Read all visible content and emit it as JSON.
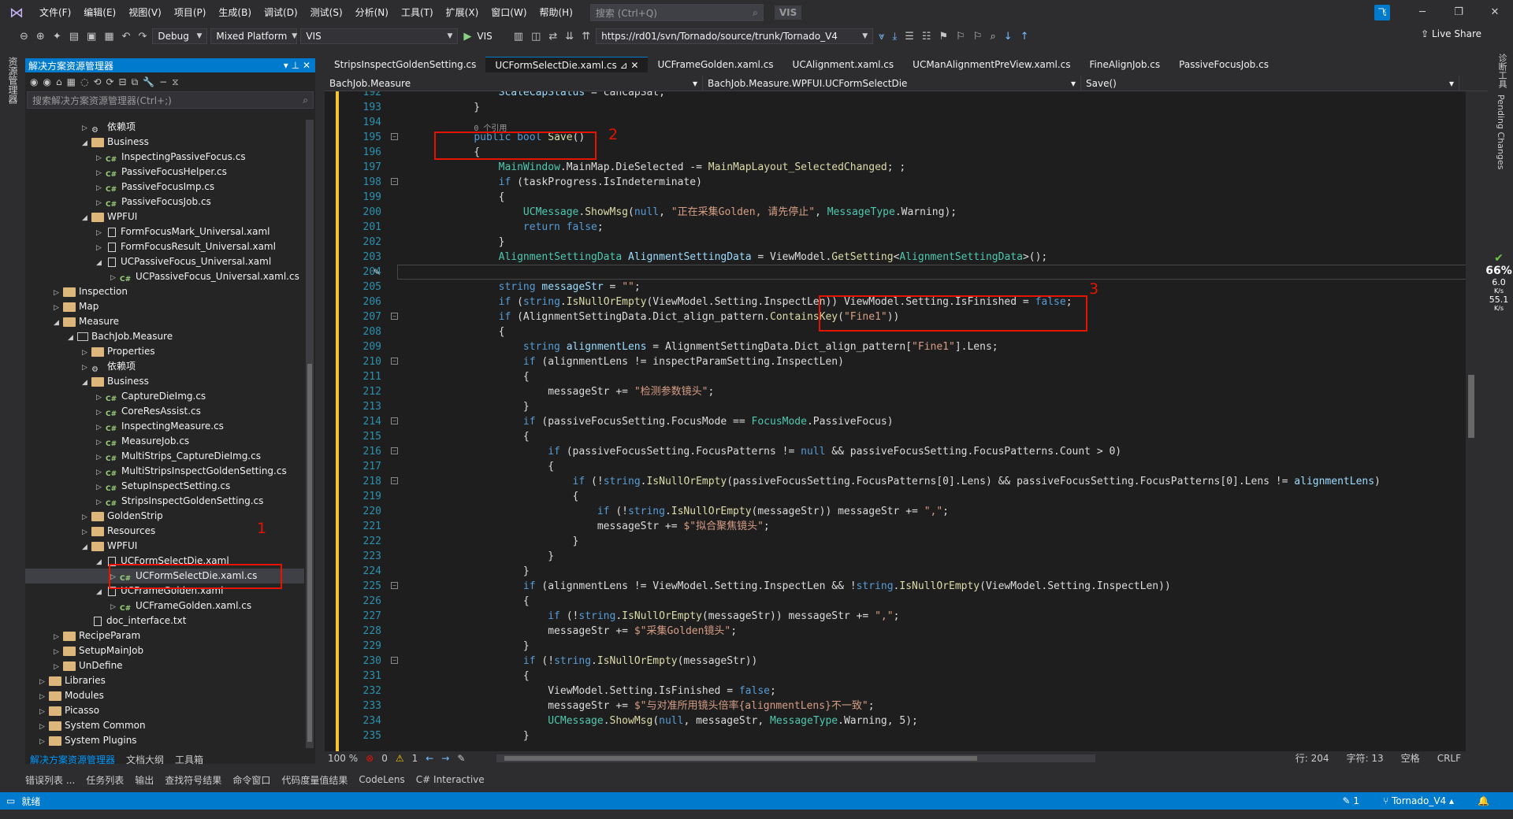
{
  "titlebar": {
    "logo": "VS",
    "menu": [
      "文件(F)",
      "编辑(E)",
      "视图(V)",
      "项目(P)",
      "生成(B)",
      "调试(D)",
      "测试(S)",
      "分析(N)",
      "工具(T)",
      "扩展(X)",
      "窗口(W)",
      "帮助(H)"
    ],
    "search_placeholder": "搜索 (Ctrl+Q)",
    "tag": "VIS",
    "avatar": "飞",
    "minimize": "─",
    "restore": "❐",
    "close": "✕"
  },
  "toolbar": {
    "config": "Debug",
    "platform": "Mixed Platform",
    "startup": "VIS",
    "run_label": "VIS",
    "url": "https://rd01/svn/Tornado/source/trunk/Tornado_V4",
    "live_share": "Live Share"
  },
  "left_strip": {
    "label": "资源管理器"
  },
  "right_strip": {
    "labels": [
      "诊断工具",
      "Pending Changes"
    ]
  },
  "solution": {
    "title": "解决方案资源管理器",
    "search_placeholder": "搜索解决方案资源管理器(Ctrl+;)",
    "tabs": [
      "解决方案资源管理器",
      "文档大纲",
      "工具箱"
    ],
    "tree": [
      {
        "label": "依赖项",
        "indent": 4,
        "icon": "ref",
        "arrow": "▷"
      },
      {
        "label": "Business",
        "indent": 4,
        "icon": "folder",
        "arrow": "◢"
      },
      {
        "label": "InspectingPassiveFocus.cs",
        "indent": 5,
        "icon": "cs",
        "arrow": "▷"
      },
      {
        "label": "PassiveFocusHelper.cs",
        "indent": 5,
        "icon": "cs",
        "arrow": "▷"
      },
      {
        "label": "PassiveFocusImp.cs",
        "indent": 5,
        "icon": "cs",
        "arrow": "▷"
      },
      {
        "label": "PassiveFocusJob.cs",
        "indent": 5,
        "icon": "cs",
        "arrow": "▷"
      },
      {
        "label": "WPFUI",
        "indent": 4,
        "icon": "folder",
        "arrow": "◢"
      },
      {
        "label": "FormFocusMark_Universal.xaml",
        "indent": 5,
        "icon": "xaml",
        "arrow": "▷"
      },
      {
        "label": "FormFocusResult_Universal.xaml",
        "indent": 5,
        "icon": "xaml",
        "arrow": "▷"
      },
      {
        "label": "UCPassiveFocus_Universal.xaml",
        "indent": 5,
        "icon": "xaml",
        "arrow": "◢"
      },
      {
        "label": "UCPassiveFocus_Universal.xaml.cs",
        "indent": 6,
        "icon": "cs",
        "arrow": "▷"
      },
      {
        "label": "Inspection",
        "indent": 2,
        "icon": "folder",
        "arrow": "▷"
      },
      {
        "label": "Map",
        "indent": 2,
        "icon": "folder",
        "arrow": "▷"
      },
      {
        "label": "Measure",
        "indent": 2,
        "icon": "folder",
        "arrow": "◢"
      },
      {
        "label": "BachJob.Measure",
        "indent": 3,
        "icon": "proj",
        "arrow": "◢"
      },
      {
        "label": "Properties",
        "indent": 4,
        "icon": "folder",
        "arrow": "▷"
      },
      {
        "label": "依赖项",
        "indent": 4,
        "icon": "ref",
        "arrow": "▷"
      },
      {
        "label": "Business",
        "indent": 4,
        "icon": "folder",
        "arrow": "◢"
      },
      {
        "label": "CaptureDieImg.cs",
        "indent": 5,
        "icon": "cs",
        "arrow": "▷"
      },
      {
        "label": "CoreResAssist.cs",
        "indent": 5,
        "icon": "cs",
        "arrow": "▷"
      },
      {
        "label": "InspectingMeasure.cs",
        "indent": 5,
        "icon": "cs",
        "arrow": "▷"
      },
      {
        "label": "MeasureJob.cs",
        "indent": 5,
        "icon": "cs",
        "arrow": "▷"
      },
      {
        "label": "MultiStrips_CaptureDieImg.cs",
        "indent": 5,
        "icon": "cs",
        "arrow": "▷"
      },
      {
        "label": "MultiStripsInspectGoldenSetting.cs",
        "indent": 5,
        "icon": "cs",
        "arrow": "▷"
      },
      {
        "label": "SetupInspectSetting.cs",
        "indent": 5,
        "icon": "cs",
        "arrow": "▷"
      },
      {
        "label": "StripsInspectGoldenSetting.cs",
        "indent": 5,
        "icon": "cs",
        "arrow": "▷"
      },
      {
        "label": "GoldenStrip",
        "indent": 4,
        "icon": "folder",
        "arrow": "▷"
      },
      {
        "label": "Resources",
        "indent": 4,
        "icon": "folder",
        "arrow": "▷"
      },
      {
        "label": "WPFUI",
        "indent": 4,
        "icon": "folder",
        "arrow": "◢"
      },
      {
        "label": "UCFormSelectDie.xaml",
        "indent": 5,
        "icon": "xaml",
        "arrow": "◢"
      },
      {
        "label": "UCFormSelectDie.xaml.cs",
        "indent": 6,
        "icon": "cs",
        "arrow": "▷",
        "selected": true
      },
      {
        "label": "UCFrameGolden.xaml",
        "indent": 5,
        "icon": "xaml",
        "arrow": "◢"
      },
      {
        "label": "UCFrameGolden.xaml.cs",
        "indent": 6,
        "icon": "cs",
        "arrow": "▷"
      },
      {
        "label": "doc_interface.txt",
        "indent": 4,
        "icon": "xaml",
        "arrow": ""
      },
      {
        "label": "RecipeParam",
        "indent": 2,
        "icon": "folder",
        "arrow": "▷"
      },
      {
        "label": "SetupMainJob",
        "indent": 2,
        "icon": "folder",
        "arrow": "▷"
      },
      {
        "label": "UnDefine",
        "indent": 2,
        "icon": "folder",
        "arrow": "▷"
      },
      {
        "label": "Libraries",
        "indent": 1,
        "icon": "folder",
        "arrow": "▷"
      },
      {
        "label": "Modules",
        "indent": 1,
        "icon": "folder",
        "arrow": "▷"
      },
      {
        "label": "Picasso",
        "indent": 1,
        "icon": "folder",
        "arrow": "▷"
      },
      {
        "label": "System Common",
        "indent": 1,
        "icon": "folder",
        "arrow": "▷"
      },
      {
        "label": "System Plugins",
        "indent": 1,
        "icon": "folder",
        "arrow": "▷"
      }
    ]
  },
  "editor_tabs": [
    "StripsInspectGoldenSetting.cs",
    "UCFormSelectDie.xaml.cs",
    "UCFrameGolden.xaml.cs",
    "UCAlignment.xaml.cs",
    "UCManAlignmentPreView.xaml.cs",
    "FineAlignJob.cs",
    "PassiveFocusJob.cs"
  ],
  "nav": {
    "project": "BachJob.Measure",
    "class": "BachJob.Measure.WPFUI.UCFormSelectDie",
    "member": "Save()"
  },
  "annotations": {
    "one": "1",
    "two": "2",
    "three": "3"
  },
  "code": [
    {
      "n": "192",
      "fold": "",
      "html": "        <span class=\"pr\">ScaleCapStatus</span> = canCapSat;"
    },
    {
      "n": "193",
      "fold": "",
      "html": "    }"
    },
    {
      "n": "194",
      "fold": "",
      "html": ""
    },
    {
      "n": "195",
      "fold": "⊟",
      "html": "    <span class=\"hint\">0 个引用</span>\n    <span class=\"kw\">public</span> <span class=\"kw\">bool</span> <span class=\"mt\">Save</span>()"
    },
    {
      "n": "196",
      "fold": "",
      "html": "    {"
    },
    {
      "n": "197",
      "fold": "",
      "html": "        <span class=\"ty\">MainWindow</span>.MainMap.DieSelected -= <span class=\"mt\">MainMapLayout_SelectedChanged</span>; ;"
    },
    {
      "n": "198",
      "fold": "⊟",
      "html": "        <span class=\"kw\">if</span> (taskProgress.IsIndeterminate)"
    },
    {
      "n": "199",
      "fold": "",
      "html": "        {"
    },
    {
      "n": "200",
      "fold": "",
      "html": "            <span class=\"ty\">UCMessage</span>.<span class=\"mt\">ShowMsg</span>(<span class=\"kw\">null</span>, <span class=\"st\">\"正在采集Golden, 请先停止\"</span>, <span class=\"ty\">MessageType</span>.Warning);"
    },
    {
      "n": "201",
      "fold": "",
      "html": "            <span class=\"kw\">return</span> <span class=\"kw\">false</span>;"
    },
    {
      "n": "202",
      "fold": "",
      "html": "        }"
    },
    {
      "n": "203",
      "fold": "",
      "html": "        <span class=\"ty\">AlignmentSettingData</span> <span class=\"pr\">AlignmentSettingData</span> = ViewModel.<span class=\"mt\">GetSetting</span>&lt;<span class=\"ty\">AlignmentSettingData</span>&gt;();"
    },
    {
      "n": "204",
      "fold": "",
      "html": "",
      "cur": true
    },
    {
      "n": "205",
      "fold": "",
      "html": "        <span class=\"kw\">string</span> <span class=\"pr\">messageStr</span> = <span class=\"st\">\"\"</span>;"
    },
    {
      "n": "206",
      "fold": "",
      "html": "        <span class=\"kw\">if</span> (<span class=\"kw\">string</span>.<span class=\"mt\">IsNullOrEmpty</span>(ViewModel.Setting.InspectLen)) ViewModel.Setting.IsFinished = <span class=\"kw\">false</span>;"
    },
    {
      "n": "207",
      "fold": "⊟",
      "html": "        <span class=\"kw\">if</span> (AlignmentSettingData.Dict_align_pattern.<span class=\"mt\">ContainsKey</span>(<span class=\"st\">\"Fine1\"</span>))"
    },
    {
      "n": "208",
      "fold": "",
      "html": "        {"
    },
    {
      "n": "209",
      "fold": "",
      "html": "            <span class=\"kw\">string</span> <span class=\"pr\">alignmentLens</span> = AlignmentSettingData.Dict_align_pattern[<span class=\"st\">\"Fine1\"</span>].Lens;"
    },
    {
      "n": "210",
      "fold": "⊟",
      "html": "            <span class=\"kw\">if</span> (alignmentLens != inspectParamSetting.InspectLen)"
    },
    {
      "n": "211",
      "fold": "",
      "html": "            {"
    },
    {
      "n": "212",
      "fold": "",
      "html": "                messageStr += <span class=\"st\">\"检测参数镜头\"</span>;"
    },
    {
      "n": "213",
      "fold": "",
      "html": "            }"
    },
    {
      "n": "214",
      "fold": "⊟",
      "html": "            <span class=\"kw\">if</span> (passiveFocusSetting.FocusMode == <span class=\"ty\">FocusMode</span>.PassiveFocus)"
    },
    {
      "n": "215",
      "fold": "",
      "html": "            {"
    },
    {
      "n": "216",
      "fold": "⊟",
      "html": "                <span class=\"kw\">if</span> (passiveFocusSetting.FocusPatterns != <span class=\"kw\">null</span> &amp;&amp; passiveFocusSetting.FocusPatterns.Count &gt; 0)"
    },
    {
      "n": "217",
      "fold": "",
      "html": "                {"
    },
    {
      "n": "218",
      "fold": "⊟",
      "html": "                    <span class=\"kw\">if</span> (!<span class=\"kw\">string</span>.<span class=\"mt\">IsNullOrEmpty</span>(passiveFocusSetting.FocusPatterns[0].Lens) &amp;&amp; passiveFocusSetting.FocusPatterns[0].Lens != <span class=\"pr\">alignmentLens</span>)"
    },
    {
      "n": "219",
      "fold": "",
      "html": "                    {"
    },
    {
      "n": "220",
      "fold": "",
      "html": "                        <span class=\"kw\">if</span> (!<span class=\"kw\">string</span>.<span class=\"mt\">IsNullOrEmpty</span>(messageStr)) messageStr += <span class=\"st\">\",\"</span>;"
    },
    {
      "n": "221",
      "fold": "",
      "html": "                        messageStr += <span class=\"st\">$\"拟合聚焦镜头\"</span>;"
    },
    {
      "n": "222",
      "fold": "",
      "html": "                    }"
    },
    {
      "n": "223",
      "fold": "",
      "html": "                }"
    },
    {
      "n": "224",
      "fold": "",
      "html": "            }"
    },
    {
      "n": "225",
      "fold": "⊟",
      "html": "            <span class=\"kw\">if</span> (alignmentLens != ViewModel.Setting.InspectLen &amp;&amp; !<span class=\"kw\">string</span>.<span class=\"mt\">IsNullOrEmpty</span>(ViewModel.Setting.InspectLen))"
    },
    {
      "n": "226",
      "fold": "",
      "html": "            {"
    },
    {
      "n": "227",
      "fold": "",
      "html": "                <span class=\"kw\">if</span> (!<span class=\"kw\">string</span>.<span class=\"mt\">IsNullOrEmpty</span>(messageStr)) messageStr += <span class=\"st\">\",\"</span>;"
    },
    {
      "n": "228",
      "fold": "",
      "html": "                messageStr += <span class=\"st\">$\"采集Golden镜头\"</span>;"
    },
    {
      "n": "229",
      "fold": "",
      "html": "            }"
    },
    {
      "n": "230",
      "fold": "⊟",
      "html": "            <span class=\"kw\">if</span> (!<span class=\"kw\">string</span>.<span class=\"mt\">IsNullOrEmpty</span>(messageStr))"
    },
    {
      "n": "231",
      "fold": "",
      "html": "            {"
    },
    {
      "n": "232",
      "fold": "",
      "html": "                ViewModel.Setting.IsFinished = <span class=\"kw\">false</span>;"
    },
    {
      "n": "233",
      "fold": "",
      "html": "                messageStr += <span class=\"st\">$\"与对准所用镜头倍率{alignmentLens}不一致\"</span>;"
    },
    {
      "n": "234",
      "fold": "",
      "html": "                <span class=\"ty\">UCMessage</span>.<span class=\"mt\">ShowMsg</span>(<span class=\"kw\">null</span>, messageStr, <span class=\"ty\">MessageType</span>.Warning, 5);"
    },
    {
      "n": "235",
      "fold": "",
      "html": "            }"
    }
  ],
  "editor_status": {
    "zoom": "100 %",
    "errors": "0",
    "warnings": "1",
    "line": "行: 204",
    "col": "字符: 13",
    "space": "空格",
    "eol": "CRLF"
  },
  "bottom_tabs": [
    "错误列表 ...",
    "任务列表",
    "输出",
    "查找符号结果",
    "命令窗口",
    "代码度量值结果",
    "CodeLens",
    "C# Interactive"
  ],
  "status": {
    "ready": "就绪",
    "pending": "1",
    "branch": "Tornado_V4"
  },
  "perf": {
    "cpu": "66%",
    "up": "6.0",
    "up_unit": "K/s",
    "down": "55.1",
    "down_unit": "K/s"
  }
}
